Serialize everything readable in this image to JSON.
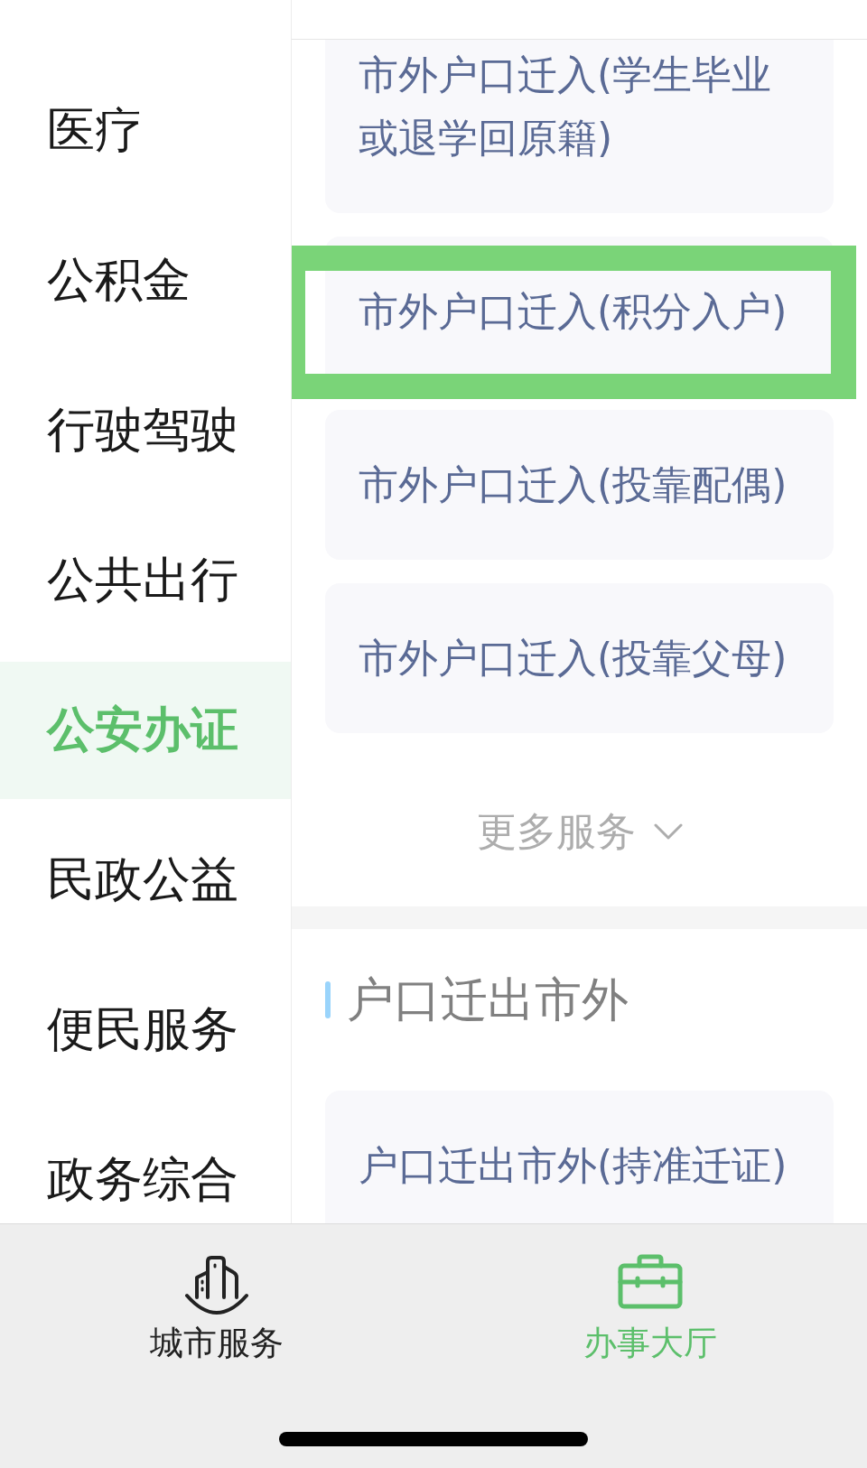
{
  "sidebar": {
    "items": [
      {
        "label": "医疗",
        "selected": false
      },
      {
        "label": "公积金",
        "selected": false
      },
      {
        "label": "行驶驾驶",
        "selected": false
      },
      {
        "label": "公共出行",
        "selected": false
      },
      {
        "label": "公安办证",
        "selected": true
      },
      {
        "label": "民政公益",
        "selected": false
      },
      {
        "label": "便民服务",
        "selected": false
      },
      {
        "label": "政务综合",
        "selected": false
      }
    ]
  },
  "content": {
    "sections": [
      {
        "cards": [
          {
            "label": "市外户口迁入(学生毕业或退学回原籍)",
            "highlighted": false
          },
          {
            "label": "市外户口迁入(积分入户)",
            "highlighted": true
          },
          {
            "label": "市外户口迁入(投靠配偶)",
            "highlighted": false
          },
          {
            "label": "市外户口迁入(投靠父母)",
            "highlighted": false
          }
        ],
        "more": "更多服务"
      },
      {
        "title": "户口迁出市外",
        "cards": [
          {
            "label": "户口迁出市外(持准迁证)",
            "highlighted": false
          }
        ]
      }
    ]
  },
  "tab_bar": {
    "tabs": [
      {
        "kind": "buildings",
        "label": "城市服务",
        "selected": false
      },
      {
        "kind": "briefcase",
        "label": "办事大厅",
        "selected": true
      }
    ]
  }
}
